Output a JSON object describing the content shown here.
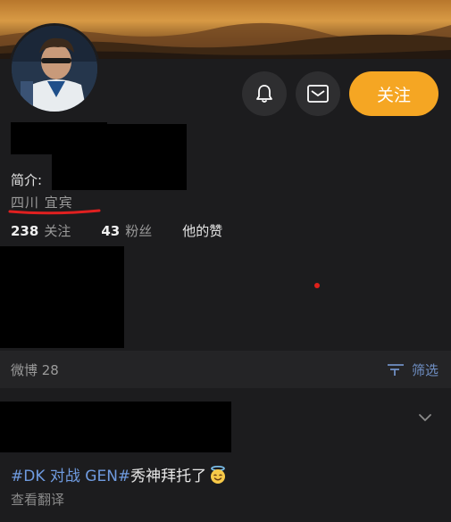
{
  "profile": {
    "bio_label": "简介:",
    "location": "四川 宜宾",
    "follow_button": "关注"
  },
  "stats": {
    "following_count": "238",
    "following_label": "关注",
    "followers_count": "43",
    "followers_label": "粉丝",
    "likes_label": "他的赞"
  },
  "feed": {
    "weibo_label": "微博 28",
    "filter_label": "筛选"
  },
  "post": {
    "hashtag": "#DK 对战 GEN#",
    "text": "秀神拜托了",
    "emoji": "smiling-face-with-halo",
    "translate_label": "查看翻译"
  },
  "colors": {
    "background": "#1c1c1e",
    "accent_follow": "#f5a623",
    "hashtag": "#6f9be0",
    "annotation_underline": "#e02020"
  }
}
